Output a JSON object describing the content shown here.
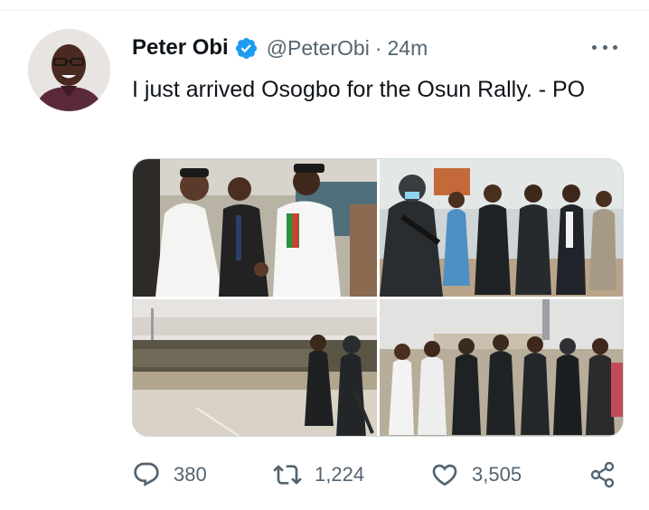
{
  "tweet": {
    "author": {
      "display_name": "Peter Obi",
      "handle": "@PeterObi",
      "verified": true
    },
    "separator": "·",
    "timestamp": "24m",
    "text": "I just arrived Osogbo for the Osun Rally. - PO",
    "media": [
      {
        "description": "handshake-photo"
      },
      {
        "description": "security-escort-photo"
      },
      {
        "description": "rally-grounds-photo"
      },
      {
        "description": "procession-photo"
      }
    ],
    "stats": {
      "replies": "380",
      "retweets": "1,224",
      "likes": "3,505"
    }
  },
  "icons": {
    "more": "more-horizontal-icon",
    "reply": "reply-icon",
    "retweet": "retweet-icon",
    "like": "heart-icon",
    "share": "share-icon",
    "verified": "verified-badge-icon"
  },
  "colors": {
    "text_primary": "#0f1419",
    "text_secondary": "#536471",
    "verified_blue": "#1d9bf0",
    "border": "#cfd9de"
  }
}
